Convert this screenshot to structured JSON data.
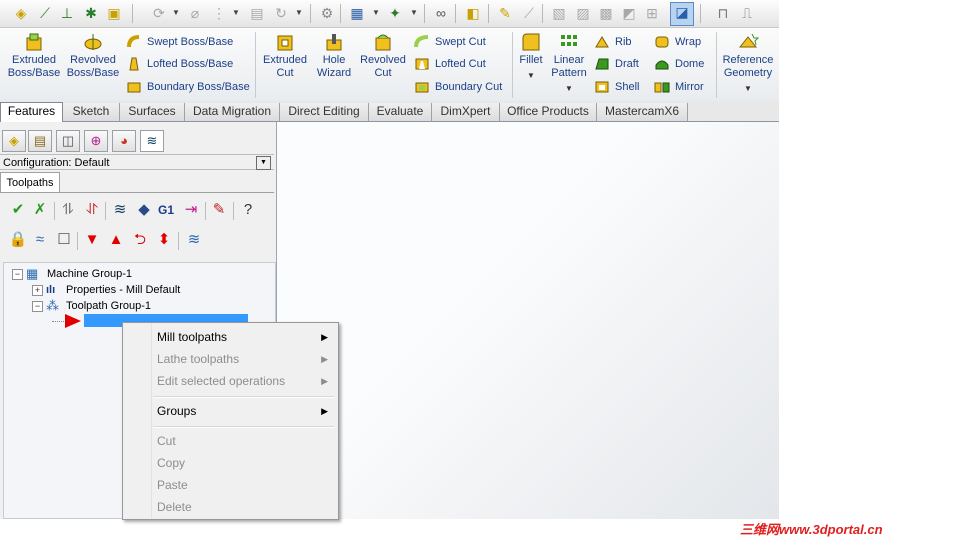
{
  "command_manager": {
    "extruded_boss": "Extruded\nBoss/Base",
    "revolved_boss": "Revolved\nBoss/Base",
    "swept_boss": "Swept Boss/Base",
    "lofted_boss": "Lofted Boss/Base",
    "boundary_boss": "Boundary Boss/Base",
    "extruded_cut": "Extruded\nCut",
    "hole_wizard": "Hole\nWizard",
    "revolved_cut": "Revolved\nCut",
    "swept_cut": "Swept Cut",
    "lofted_cut": "Lofted Cut",
    "boundary_cut": "Boundary Cut",
    "fillet": "Fillet",
    "linear_pattern": "Linear\nPattern",
    "rib": "Rib",
    "draft": "Draft",
    "shell": "Shell",
    "wrap": "Wrap",
    "dome": "Dome",
    "mirror": "Mirror",
    "reference_geometry": "Reference\nGeometry"
  },
  "tabs": [
    "Features",
    "Sketch",
    "Surfaces",
    "Data Migration",
    "Direct Editing",
    "Evaluate",
    "DimXpert",
    "Office Products",
    "MastercamX6"
  ],
  "left_panel": {
    "configuration": "Configuration:  Default",
    "sub_tab": "Toolpaths"
  },
  "tree": {
    "machine_group": "Machine Group-1",
    "properties": "Properties - Mill Default",
    "toolpath_group": "Toolpath Group-1"
  },
  "context_menu": {
    "mill_toolpaths": "Mill toolpaths",
    "lathe_toolpaths": "Lathe toolpaths",
    "edit_selected": "Edit selected operations",
    "groups": "Groups",
    "cut": "Cut",
    "copy": "Copy",
    "paste": "Paste",
    "delete": "Delete"
  },
  "watermark": "三维网www.3dportal.cn",
  "colors": {
    "accent_blue": "#3399ff",
    "text_blue": "#1c3f87",
    "arrow_red": "#e00000"
  }
}
